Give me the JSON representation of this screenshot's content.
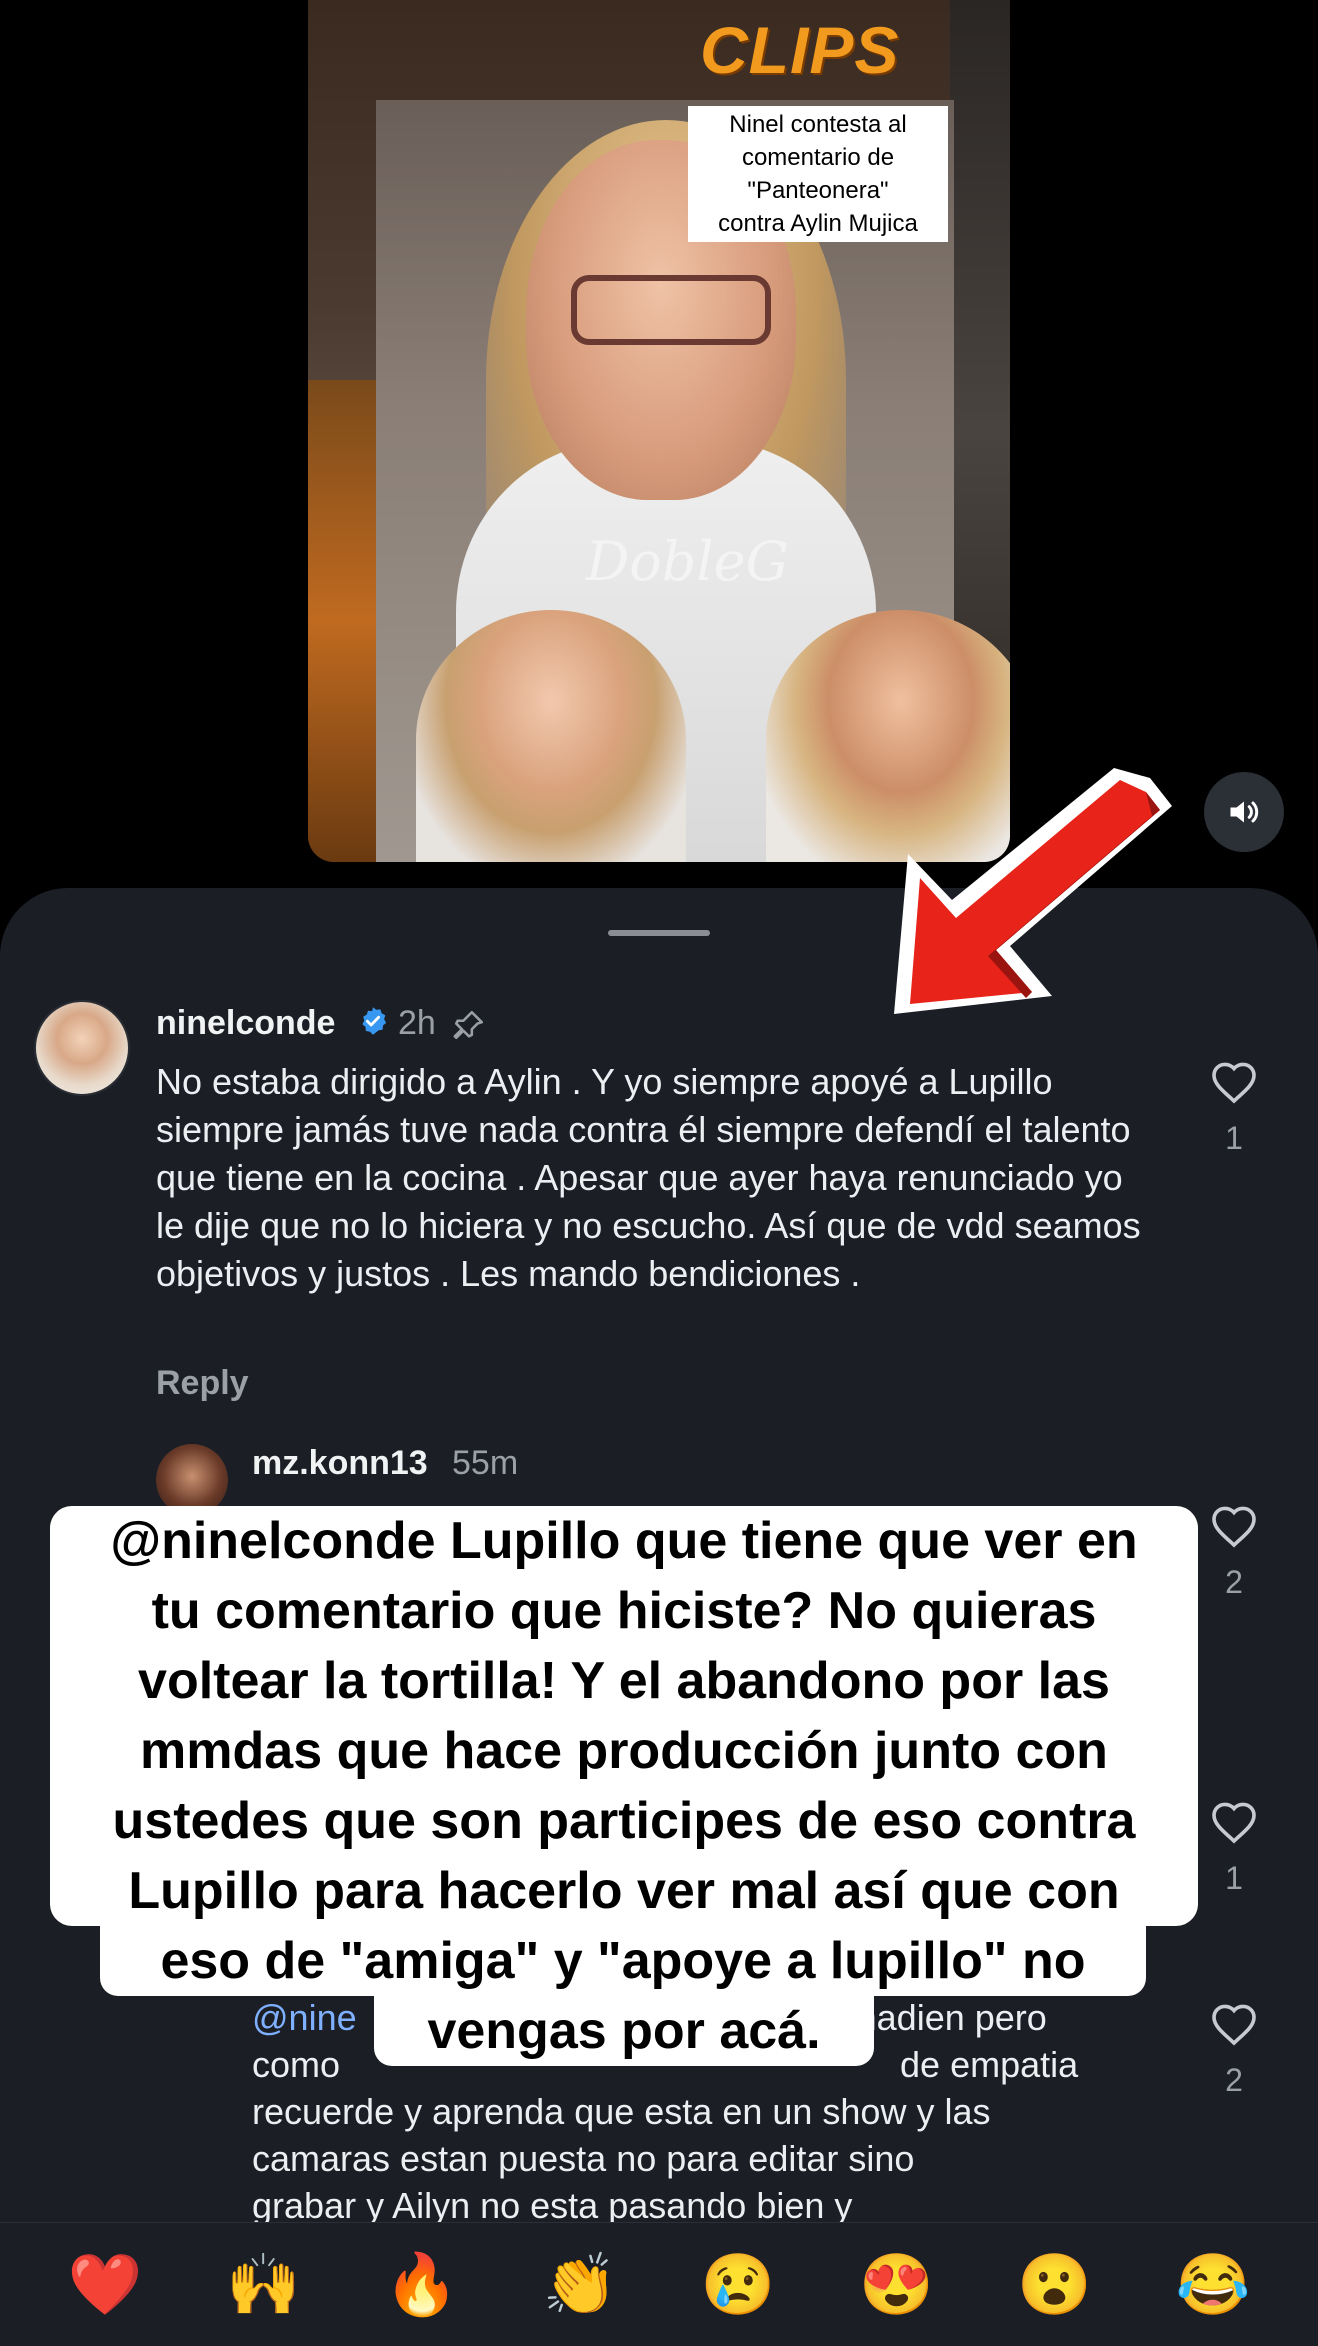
{
  "video": {
    "brand": "CLIPS",
    "caption": "Ninel contesta al\ncomentario de\n\"Panteonera\"\ncontra Aylin Mujica",
    "watermark": "DobleG"
  },
  "comment": {
    "username": "ninelconde",
    "time": "2h",
    "text": "No estaba dirigido a Aylin . Y yo siempre apoyé a Lupillo siempre jamás tuve nada contra él siempre defendí el talento que tiene en la cocina . Apesar que ayer haya renunciado yo le dije que no lo hiciera y no escucho. Así que de vdd seamos objetivos y justos . Les mando bendiciones .",
    "likes": "1",
    "reply_label": "Reply"
  },
  "reply": {
    "username": "mz.konn13",
    "time": "55m",
    "likes": "2"
  },
  "hidden_replies": [
    {
      "likes": "1"
    },
    {
      "likes": "2"
    }
  ],
  "partial_reply": {
    "mention": "@nine",
    "text_after_mention": "a nadien pero",
    "line2_start": "como",
    "line2_end": "de empatia",
    "line3": "recuerde y aprenda que esta en un show y las",
    "line4": "camaras estan puesta no para editar sino",
    "line5": "grabar y Ailyn no esta pasando bien y"
  },
  "overlay_caption": [
    "@ninelconde Lupillo que tiene que ver en",
    "tu comentario que hiciste? No quieras",
    "voltear la tortilla! Y el abandono por las",
    "mmdas que hace producción junto con",
    "ustedes que son participes de eso contra",
    "Lupillo para hacerlo ver mal así que con",
    "eso de \"amiga\" y \"apoye a lupillo\" no",
    "vengas por acá."
  ],
  "emoji_bar": [
    "❤️",
    "🙌",
    "🔥",
    "👏",
    "😢",
    "😍",
    "😮",
    "😂"
  ],
  "colors": {
    "sheet_bg": "#1b1f25",
    "verified_blue": "#3897f0",
    "arrow_red": "#e8231a",
    "clips_orange": "#f29a1e"
  }
}
